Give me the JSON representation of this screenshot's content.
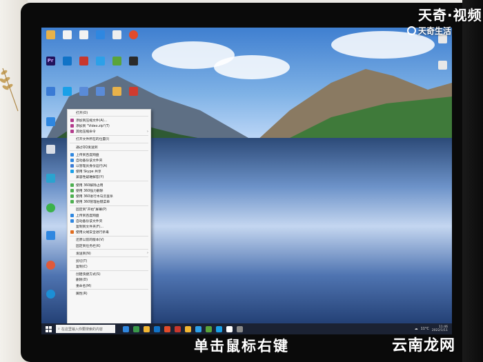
{
  "overlay": {
    "brand_large": "天奇·视频",
    "brand_small": "天奇生活",
    "caption": "单击鼠标右键",
    "watermark": "云南龙网"
  },
  "colors": {
    "menu_bg": "#f7f7f7",
    "taskbar_bg": "#1b2233",
    "sky": "#3f7fd0",
    "lake": "#4f74b1"
  },
  "desktop": {
    "icons": [
      {
        "label": "",
        "color": "#e8b24a"
      },
      {
        "label": "",
        "color": "#f2f2f2"
      },
      {
        "label": "",
        "color": "#f2f2f2"
      },
      {
        "label": "",
        "color": "#2f87e0"
      },
      {
        "label": "",
        "color": "#eeeeee"
      },
      {
        "label": "",
        "color": "#e34b2a"
      },
      {
        "label": "Pr",
        "color": "#22135c"
      },
      {
        "label": "",
        "color": "#1173c7"
      },
      {
        "label": "",
        "color": "#c8372d"
      },
      {
        "label": "",
        "color": "#2da0e8"
      },
      {
        "label": "",
        "color": "#5aa43a"
      },
      {
        "label": "",
        "color": "#2a2a2a"
      }
    ]
  },
  "context_menu": {
    "items": [
      {
        "label": "打开(O)",
        "icon": "none",
        "color": "",
        "arrow": ""
      },
      {
        "label": "添加到压缩文件(A)...",
        "icon": "archive-icon",
        "color": "#b33b8c",
        "arrow": ""
      },
      {
        "label": "添加到 \"Video.zip\"(T)",
        "icon": "archive-icon",
        "color": "#b33b8c",
        "arrow": ""
      },
      {
        "label": "其他压缩命令",
        "icon": "archive-icon",
        "color": "#b33b8c",
        "arrow": "›"
      },
      {
        "label": "打开文件所在的位置(I)",
        "icon": "none",
        "color": "",
        "arrow": ""
      },
      {
        "label": "通过QQ发送到",
        "icon": "none",
        "color": "",
        "arrow": ""
      },
      {
        "label": "上传到百度网盘",
        "icon": "cloud-icon",
        "color": "#2f87e0",
        "arrow": ""
      },
      {
        "label": "自动备份该文件夹",
        "icon": "cloud-icon",
        "color": "#2f87e0",
        "arrow": ""
      },
      {
        "label": "以管理员身份运行(A)",
        "icon": "shield-icon",
        "color": "#3a7bd5",
        "arrow": ""
      },
      {
        "label": "使用 Skype 共享",
        "icon": "skype-icon",
        "color": "#1aa0e8",
        "arrow": ""
      },
      {
        "label": "兼容性疑难解答(Y)",
        "icon": "none",
        "color": "",
        "arrow": ""
      },
      {
        "label": "使用 360解除占用",
        "icon": "shield-icon",
        "color": "#4caf50",
        "arrow": ""
      },
      {
        "label": "使用 360强力删除",
        "icon": "shield-icon",
        "color": "#4caf50",
        "arrow": ""
      },
      {
        "label": "使用 360进行木马云查杀",
        "icon": "shield-icon",
        "color": "#4caf50",
        "arrow": ""
      },
      {
        "label": "使用 360管理右键菜单",
        "icon": "shield-icon",
        "color": "#4caf50",
        "arrow": ""
      },
      {
        "label": "固定到\"开始\"屏幕(P)",
        "icon": "none",
        "color": "",
        "arrow": ""
      },
      {
        "label": "上传到百度网盘",
        "icon": "cloud-icon",
        "color": "#2f87e0",
        "arrow": ""
      },
      {
        "label": "自动备份该文件夹",
        "icon": "cloud-icon",
        "color": "#2f87e0",
        "arrow": ""
      },
      {
        "label": "复制到文件夹(F)...",
        "icon": "none",
        "color": "",
        "arrow": ""
      },
      {
        "label": "使用火绒安全进行杀毒",
        "icon": "shield-icon",
        "color": "#e06c1e",
        "arrow": ""
      },
      {
        "label": "还原以前的版本(V)",
        "icon": "none",
        "color": "",
        "arrow": ""
      },
      {
        "label": "固定到任务栏(K)",
        "icon": "none",
        "color": "",
        "arrow": ""
      },
      {
        "label": "发送到(N)",
        "icon": "none",
        "color": "",
        "arrow": "›"
      },
      {
        "label": "剪切(T)",
        "icon": "none",
        "color": "",
        "arrow": ""
      },
      {
        "label": "复制(C)",
        "icon": "none",
        "color": "",
        "arrow": ""
      },
      {
        "label": "创建快捷方式(S)",
        "icon": "none",
        "color": "",
        "arrow": ""
      },
      {
        "label": "删除(D)",
        "icon": "none",
        "color": "",
        "arrow": ""
      },
      {
        "label": "重命名(M)",
        "icon": "none",
        "color": "",
        "arrow": ""
      },
      {
        "label": "属性(R)",
        "icon": "none",
        "color": "",
        "arrow": ""
      }
    ],
    "separators_after": [
      0,
      3,
      4,
      5,
      10,
      14,
      19,
      21,
      22,
      24,
      27
    ]
  },
  "taskbar": {
    "search_placeholder": "在这里输入你要搜索的内容",
    "weather": "11°C",
    "time": "11:46",
    "date": "2022/1/11",
    "apps": [
      "#2f87e0",
      "#3a9a4a",
      "#f2b632",
      "#1173c7",
      "#e34b2a",
      "#c8372d",
      "#f2b632",
      "#2da0e8",
      "#5aa43a",
      "#1aa0e8",
      "#ffffff",
      "#8a8a8a"
    ]
  }
}
